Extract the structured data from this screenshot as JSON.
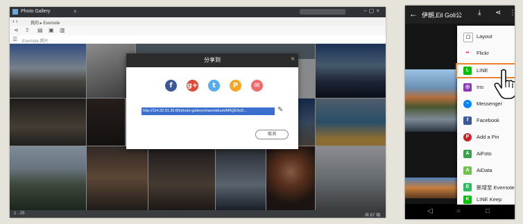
{
  "desktop": {
    "app_title": "Photo Gallery",
    "breadcrumb": "我的 ▸ Evernote",
    "subbar_text": "Evernote 照片",
    "status_left": "1 - 25",
    "status_right": "共 67 項",
    "dialog": {
      "title": "分享到",
      "share_url": "http://114.32.91.30:80/photo-gallery/share/album/M6QE0uD...",
      "cancel_label": "取消",
      "social": [
        {
          "name": "Facebook",
          "glyph": "f",
          "color": "#3b5998"
        },
        {
          "name": "Google+",
          "glyph": "g+",
          "color": "#dd4b39"
        },
        {
          "name": "Twitter",
          "glyph": "t",
          "color": "#55acee"
        },
        {
          "name": "Plurk",
          "glyph": "P",
          "color": "#f6a623"
        },
        {
          "name": "Email",
          "glyph": "✉",
          "color": "#ef6a6a"
        }
      ]
    }
  },
  "phone": {
    "title": "伊朗,Eil Goli公",
    "menu": [
      {
        "label": "Layout",
        "icon": "layout-icon",
        "color": "#ffffff",
        "glyph": "▢"
      },
      {
        "label": "Flickr",
        "icon": "flickr-icon",
        "color": "#ffffff",
        "glyph": "••"
      },
      {
        "label": "LINE",
        "icon": "line-icon",
        "color": "#00c300",
        "glyph": "L"
      },
      {
        "label": "Ins",
        "icon": "instagram-icon",
        "color": "#8a3ab9",
        "glyph": "◎"
      },
      {
        "label": "Messenger",
        "icon": "messenger-icon",
        "color": "#0084ff",
        "glyph": "~"
      },
      {
        "label": "Facebook",
        "icon": "facebook-icon",
        "color": "#3b5998",
        "glyph": "f"
      },
      {
        "label": "Add a Pin",
        "icon": "pinterest-icon",
        "color": "#cb2027",
        "glyph": "P"
      },
      {
        "label": "AiFoto",
        "icon": "aifoto-icon",
        "color": "#3aa14a",
        "glyph": "A"
      },
      {
        "label": "AiData",
        "icon": "aidata-icon",
        "color": "#6fc24b",
        "glyph": "A"
      },
      {
        "label": "新增至 Evernote",
        "icon": "evernote-icon",
        "color": "#2dbe60",
        "glyph": "E"
      },
      {
        "label": "LINE Keep",
        "icon": "line-keep-icon",
        "color": "#00c300",
        "glyph": "K"
      }
    ]
  }
}
